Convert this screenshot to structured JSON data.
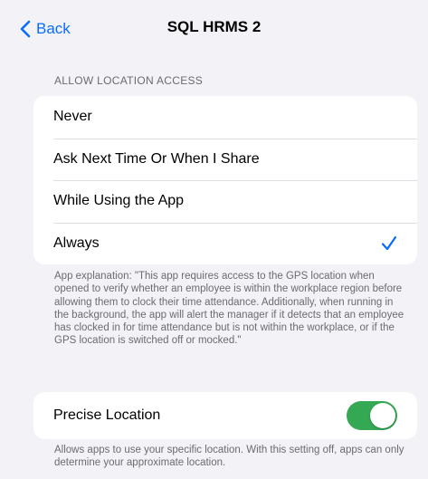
{
  "nav": {
    "back_label": "Back",
    "title": "SQL HRMS 2"
  },
  "location_access": {
    "header": "ALLOW LOCATION ACCESS",
    "options": [
      {
        "label": "Never",
        "selected": false
      },
      {
        "label": "Ask Next Time Or When I Share",
        "selected": false
      },
      {
        "label": "While Using the App",
        "selected": false
      },
      {
        "label": "Always",
        "selected": true
      }
    ],
    "explanation": "App explanation: \"This app requires access to the GPS location when opened to verify whether an employee is within the workplace region before allowing them to clock their time attendance. Additionally, when running in the background, the app will alert the manager if it detects that an employee has clocked in for time attendance but is not within the workplace, or if the GPS location is switched off or mocked.\""
  },
  "precise_location": {
    "label": "Precise Location",
    "enabled": true,
    "description": "Allows apps to use your specific location. With this setting off, apps can only determine your approximate location."
  },
  "colors": {
    "accent": "#0a6cff",
    "toggle_on": "#34a853",
    "background": "#f2f2f7"
  }
}
